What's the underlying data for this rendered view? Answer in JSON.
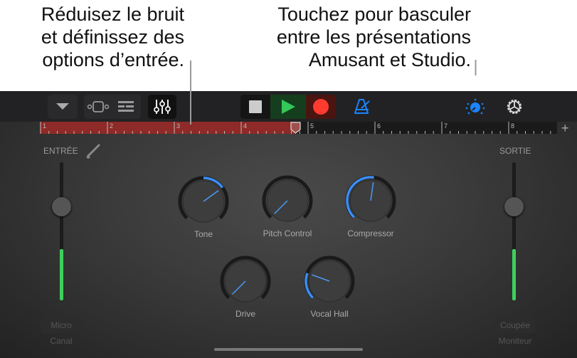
{
  "callouts": {
    "left": [
      "Réduisez le bruit",
      "et définissez des",
      "options d’entrée."
    ],
    "right": [
      "Touchez pour basculer",
      "entre les présentations",
      "Amusant et Studio."
    ]
  },
  "toolbar": {
    "icons": [
      "browser-dropdown-icon",
      "tracks-view-icon",
      "list-view-icon",
      "mixer-controls-icon",
      "stop-icon",
      "play-icon",
      "record-icon",
      "metronome-icon",
      "amusant-studio-toggle-icon",
      "settings-gear-icon"
    ]
  },
  "ruler": {
    "bars": [
      "1",
      "2",
      "3",
      "4",
      "5",
      "6",
      "7",
      "8"
    ],
    "add": "+"
  },
  "input": {
    "label": "ENTRÉE",
    "level": 0.37,
    "thumb": 0.32,
    "button": "Micro",
    "sub": "Canal"
  },
  "output": {
    "label": "SORTIE",
    "level": 0.37,
    "thumb": 0.32,
    "button": "Coupée",
    "sub": "Moniteur"
  },
  "knobs": [
    {
      "label": "Tone",
      "value": 0.7,
      "arc_from": 0.5
    },
    {
      "label": "Pitch Control",
      "value": 0.0,
      "arc_from": 0.0
    },
    {
      "label": "Compressor",
      "value": 0.53,
      "arc_from": 0.0
    },
    {
      "label": "Drive",
      "value": 0.0,
      "arc_from": 0.0
    },
    {
      "label": "Vocal Hall",
      "value": 0.24,
      "arc_from": 0.0
    }
  ],
  "colors": {
    "accent": "#1a84ff",
    "record": "#ff3b30",
    "play": "#34c759",
    "level": "#3ecf5c",
    "cycle": "#8e2a27"
  }
}
